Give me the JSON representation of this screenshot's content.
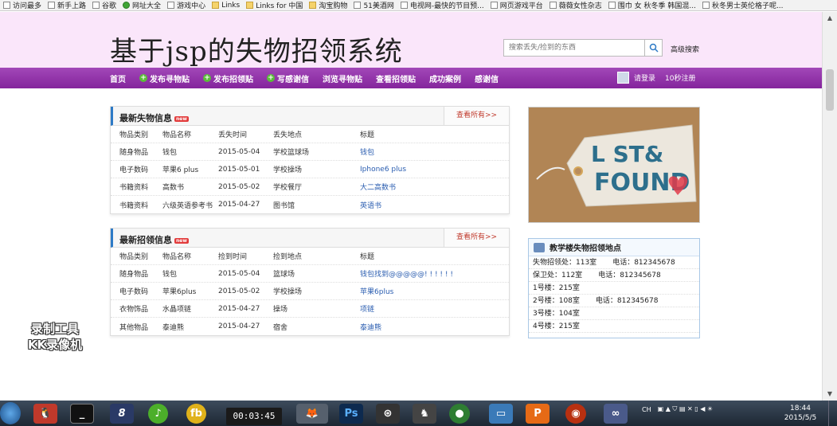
{
  "bookmarks": [
    {
      "label": "访问最多",
      "icon": "page-icon"
    },
    {
      "label": "新手上路",
      "icon": "page-icon"
    },
    {
      "label": "谷歌",
      "icon": "page-icon"
    },
    {
      "label": "网址大全",
      "icon": "site-icon"
    },
    {
      "label": "游戏中心",
      "icon": "page-icon"
    },
    {
      "label": "Links",
      "icon": "folder-icon"
    },
    {
      "label": "Links for 中国",
      "icon": "folder-icon"
    },
    {
      "label": "淘宝购物",
      "icon": "folder-icon"
    },
    {
      "label": "51美酒网",
      "icon": "page-icon"
    },
    {
      "label": "电视网-最快的节目预...",
      "icon": "page-icon"
    },
    {
      "label": "网页游戏平台",
      "icon": "page-icon"
    },
    {
      "label": "薇薇女性杂志",
      "icon": "page-icon"
    },
    {
      "label": "围巾 女 秋冬季 韩国混...",
      "icon": "page-icon"
    },
    {
      "label": "秋冬男士英伦格子呢...",
      "icon": "page-icon"
    }
  ],
  "header": {
    "site_title": "基于jsp的失物招领系统",
    "search_placeholder": "搜索丢失/捡到的东西",
    "advanced_search": "高级搜索"
  },
  "nav": {
    "items": [
      {
        "label": "首页",
        "plus": false
      },
      {
        "label": "发布寻物贴",
        "plus": true
      },
      {
        "label": "发布招领贴",
        "plus": true
      },
      {
        "label": "写感谢信",
        "plus": true
      },
      {
        "label": "浏览寻物贴",
        "plus": false
      },
      {
        "label": "查看招领贴",
        "plus": false
      },
      {
        "label": "成功案例",
        "plus": false
      },
      {
        "label": "感谢信",
        "plus": false
      }
    ],
    "login": "请登录",
    "register": "10秒注册"
  },
  "lost_panel": {
    "title": "最新失物信息",
    "badge": "new",
    "view_all": "查看所有>>",
    "headers": [
      "物品类别",
      "物品名称",
      "丢失时间",
      "丢失地点",
      "标题"
    ],
    "rows": [
      [
        "随身物品",
        "钱包",
        "2015-05-04",
        "学校篮球场",
        "钱包"
      ],
      [
        "电子数码",
        "苹果6 plus",
        "2015-05-01",
        "学校操场",
        "Iphone6 plus"
      ],
      [
        "书籍资料",
        "高数书",
        "2015-05-02",
        "学校餐厅",
        "大二高数书"
      ],
      [
        "书籍资料",
        "六级英语参考书",
        "2015-04-27",
        "图书馆",
        "英语书"
      ]
    ]
  },
  "found_panel": {
    "title": "最新招领信息",
    "badge": "new",
    "view_all": "查看所有>>",
    "headers": [
      "物品类别",
      "物品名称",
      "捡到时间",
      "捡到地点",
      "标题"
    ],
    "rows": [
      [
        "随身物品",
        "钱包",
        "2015-05-04",
        "篮球场",
        "钱包找到@@@@@! ! ! ! ! !"
      ],
      [
        "电子数码",
        "苹果6plus",
        "2015-05-02",
        "学校操场",
        "苹果6plus"
      ],
      [
        "衣物饰品",
        "水晶项链",
        "2015-04-27",
        "操场",
        "项链"
      ],
      [
        "其他物品",
        "泰迪熊",
        "2015-04-27",
        "宿舍",
        "泰迪熊"
      ]
    ]
  },
  "banner": {
    "line1": "L ST&",
    "line2": "FOUND"
  },
  "locations": {
    "title": "教学楼失物招领地点",
    "rows": [
      {
        "place": "失物招领处：113室",
        "phone": "电话：812345678"
      },
      {
        "place": "保卫处：112室",
        "phone": "电话：812345678"
      },
      {
        "place": "1号楼：215室",
        "phone": ""
      },
      {
        "place": "2号楼：108室",
        "phone": "电话：812345678"
      },
      {
        "place": "3号楼：104室",
        "phone": ""
      },
      {
        "place": "4号楼：215室",
        "phone": ""
      }
    ]
  },
  "watermark": {
    "line1": "录制工具",
    "line2": "KK录像机"
  },
  "taskbar": {
    "timer": "00:03:45",
    "lang": "CH",
    "time": "18:44",
    "date": "2015/5/5"
  },
  "colors": {
    "header_bg": "#fae6fa",
    "nav_bg": "#8e2ea6",
    "link": "#2a5db0",
    "accent": "#2d7ac6"
  }
}
